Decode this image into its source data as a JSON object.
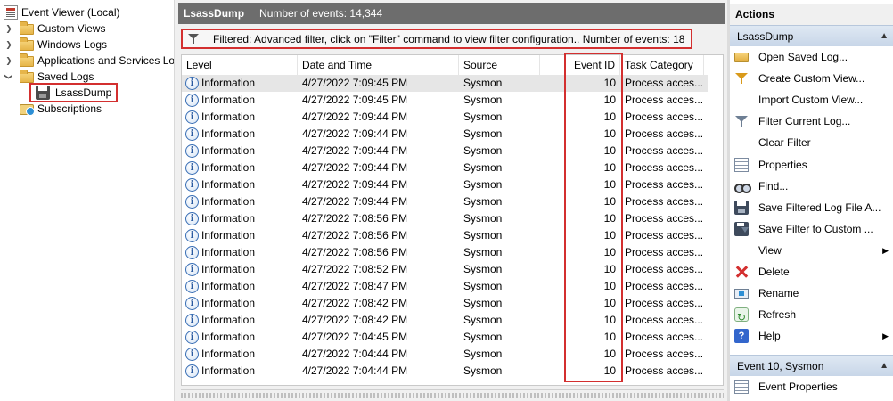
{
  "tree": {
    "root": "Event Viewer (Local)",
    "items": [
      {
        "label": "Custom Views",
        "icon": "folder-icon",
        "expander": "chevron-right"
      },
      {
        "label": "Windows Logs",
        "icon": "folder-icon",
        "expander": "chevron-right"
      },
      {
        "label": "Applications and Services Logs",
        "icon": "folder-icon",
        "expander": "chevron-right"
      },
      {
        "label": "Saved Logs",
        "icon": "folder-icon",
        "expander": "chevron-down"
      },
      {
        "label": "LsassDump",
        "icon": "saved-log-icon",
        "expander": "none"
      },
      {
        "label": "Subscriptions",
        "icon": "subscriptions-icon",
        "expander": "none"
      }
    ]
  },
  "center": {
    "title": "LsassDump",
    "event_count": "Number of events: 14,344",
    "filter_text": "Filtered: Advanced filter, click on \"Filter\" command to view filter configuration.. Number of events: 18",
    "columns": [
      "Level",
      "Date and Time",
      "Source",
      "Event ID",
      "Task Category"
    ],
    "rows": [
      {
        "level": "Information",
        "date": "4/27/2022 7:09:45 PM",
        "source": "Sysmon",
        "event_id": "10",
        "task": "Process acces..."
      },
      {
        "level": "Information",
        "date": "4/27/2022 7:09:45 PM",
        "source": "Sysmon",
        "event_id": "10",
        "task": "Process acces..."
      },
      {
        "level": "Information",
        "date": "4/27/2022 7:09:44 PM",
        "source": "Sysmon",
        "event_id": "10",
        "task": "Process acces..."
      },
      {
        "level": "Information",
        "date": "4/27/2022 7:09:44 PM",
        "source": "Sysmon",
        "event_id": "10",
        "task": "Process acces..."
      },
      {
        "level": "Information",
        "date": "4/27/2022 7:09:44 PM",
        "source": "Sysmon",
        "event_id": "10",
        "task": "Process acces..."
      },
      {
        "level": "Information",
        "date": "4/27/2022 7:09:44 PM",
        "source": "Sysmon",
        "event_id": "10",
        "task": "Process acces..."
      },
      {
        "level": "Information",
        "date": "4/27/2022 7:09:44 PM",
        "source": "Sysmon",
        "event_id": "10",
        "task": "Process acces..."
      },
      {
        "level": "Information",
        "date": "4/27/2022 7:09:44 PM",
        "source": "Sysmon",
        "event_id": "10",
        "task": "Process acces..."
      },
      {
        "level": "Information",
        "date": "4/27/2022 7:08:56 PM",
        "source": "Sysmon",
        "event_id": "10",
        "task": "Process acces..."
      },
      {
        "level": "Information",
        "date": "4/27/2022 7:08:56 PM",
        "source": "Sysmon",
        "event_id": "10",
        "task": "Process acces..."
      },
      {
        "level": "Information",
        "date": "4/27/2022 7:08:56 PM",
        "source": "Sysmon",
        "event_id": "10",
        "task": "Process acces..."
      },
      {
        "level": "Information",
        "date": "4/27/2022 7:08:52 PM",
        "source": "Sysmon",
        "event_id": "10",
        "task": "Process acces..."
      },
      {
        "level": "Information",
        "date": "4/27/2022 7:08:47 PM",
        "source": "Sysmon",
        "event_id": "10",
        "task": "Process acces..."
      },
      {
        "level": "Information",
        "date": "4/27/2022 7:08:42 PM",
        "source": "Sysmon",
        "event_id": "10",
        "task": "Process acces..."
      },
      {
        "level": "Information",
        "date": "4/27/2022 7:08:42 PM",
        "source": "Sysmon",
        "event_id": "10",
        "task": "Process acces..."
      },
      {
        "level": "Information",
        "date": "4/27/2022 7:04:45 PM",
        "source": "Sysmon",
        "event_id": "10",
        "task": "Process acces..."
      },
      {
        "level": "Information",
        "date": "4/27/2022 7:04:44 PM",
        "source": "Sysmon",
        "event_id": "10",
        "task": "Process acces..."
      },
      {
        "level": "Information",
        "date": "4/27/2022 7:04:44 PM",
        "source": "Sysmon",
        "event_id": "10",
        "task": "Process acces..."
      }
    ]
  },
  "actions": {
    "header": "Actions",
    "section1": "LsassDump",
    "items": [
      {
        "label": "Open Saved Log...",
        "icon": "open-saved-log-icon"
      },
      {
        "label": "Create Custom View...",
        "icon": "create-custom-view-icon"
      },
      {
        "label": "Import Custom View...",
        "icon": "none"
      },
      {
        "label": "Filter Current Log...",
        "icon": "filter-current-log-icon"
      },
      {
        "label": "Clear Filter",
        "icon": "none"
      },
      {
        "label": "Properties",
        "icon": "properties-icon"
      },
      {
        "label": "Find...",
        "icon": "find-icon"
      },
      {
        "label": "Save Filtered Log File A...",
        "icon": "save-filtered-log-icon"
      },
      {
        "label": "Save Filter to Custom ...",
        "icon": "save-filter-icon"
      },
      {
        "label": "View",
        "icon": "none",
        "submenu": true
      },
      {
        "label": "Delete",
        "icon": "delete-icon"
      },
      {
        "label": "Rename",
        "icon": "rename-icon"
      },
      {
        "label": "Refresh",
        "icon": "refresh-icon"
      },
      {
        "label": "Help",
        "icon": "help-icon",
        "submenu": true
      }
    ],
    "section2": "Event 10, Sysmon",
    "items2": [
      {
        "label": "Event Properties",
        "icon": "event-properties-icon"
      }
    ]
  },
  "colors": {
    "highlight_box": "#d32f2f",
    "header_bg": "#6d6d6d",
    "section_bg": "#c8d6e8",
    "selected_row": "#e6e6e6"
  }
}
